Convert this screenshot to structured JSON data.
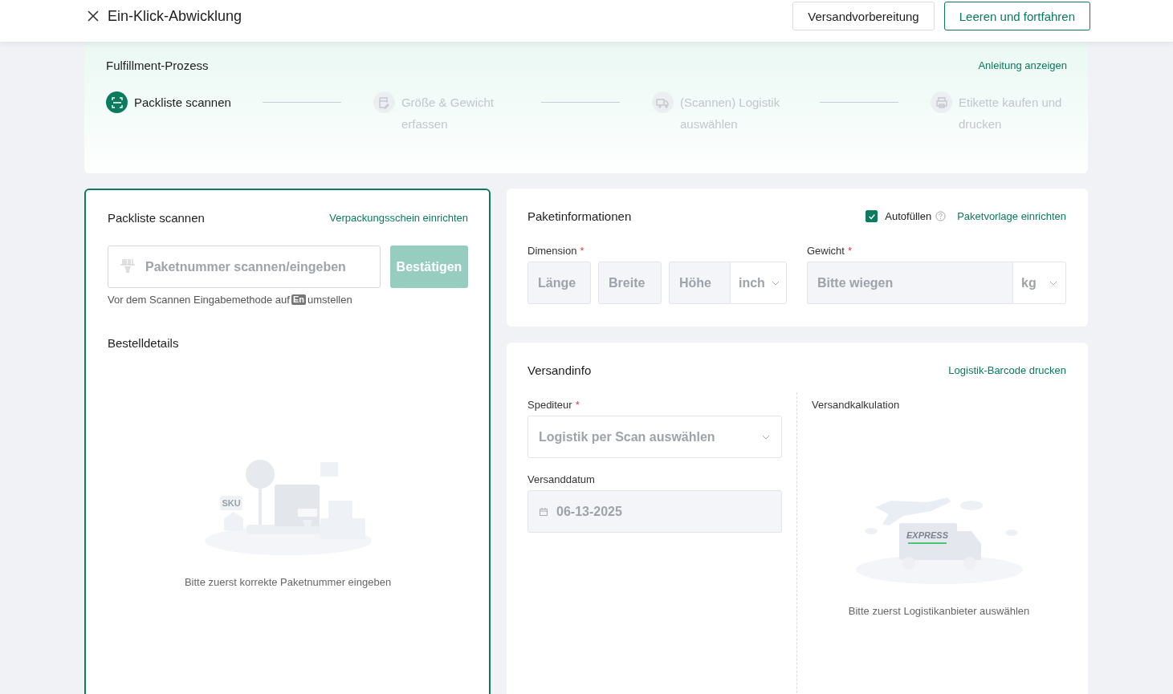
{
  "header": {
    "title": "Ein-Klick-Abwicklung",
    "buttons": [
      {
        "label": "Versandvorbereitung",
        "kind": "default"
      },
      {
        "label": "Leeren und fortfahren",
        "kind": "outline"
      }
    ]
  },
  "process": {
    "title": "Fulfillment-Prozess",
    "link": "Anleitung anzeigen",
    "steps": [
      {
        "label": "Packliste scannen",
        "active": true,
        "kind": "scan"
      },
      {
        "label": "Größe & Gewicht erfassen",
        "active": false,
        "kind": "form"
      },
      {
        "label": "(Scannen) Logistik auswählen",
        "active": false,
        "kind": "truck"
      },
      {
        "label": "Etikette kaufen und drucken",
        "active": false,
        "kind": "printer"
      }
    ]
  },
  "scan_panel": {
    "title": "Packliste scannen",
    "link": "Verpackungsschein einrichten",
    "input": {
      "placeholder": "Paketnummer scannen/eingeben"
    },
    "confirm": {
      "label": "Bestätigen",
      "disabled": true
    },
    "hint": {
      "before": "Vor dem Scannen Eingabemethode auf",
      "key": "En",
      "after": "umstellen"
    },
    "section": "Bestelldetails",
    "illustration_label": "SKU",
    "empty_text": "Bitte zuerst korrekte Paketnummer eingeben"
  },
  "package": {
    "title": "Paketinformationen",
    "autofill": {
      "label": "Autofüllen",
      "checked": true
    },
    "link": "Paketvorlage einrichten",
    "dimension": {
      "label": "Dimension",
      "required_mark": "*",
      "fields": [
        {
          "placeholder": "Länge"
        },
        {
          "placeholder": "Breite"
        },
        {
          "placeholder": "Höhe"
        }
      ],
      "unit": "inch"
    },
    "weight": {
      "label": "Gewicht",
      "required_mark": "*",
      "placeholder": "Bitte wiegen",
      "unit": "kg"
    }
  },
  "shipping": {
    "title": "Versandinfo",
    "link": "Logistik-Barcode drucken",
    "carrier": {
      "label": "Spediteur",
      "required_mark": "*",
      "placeholder": "Logistik per Scan auswählen"
    },
    "date": {
      "label": "Versanddatum",
      "value": "06-13-2025",
      "disabled": true
    },
    "calc": {
      "title": "Versandkalkulation",
      "illustration_label": "EXPRESS",
      "empty_text": "Bitte zuerst Logistikanbieter auswählen"
    }
  }
}
